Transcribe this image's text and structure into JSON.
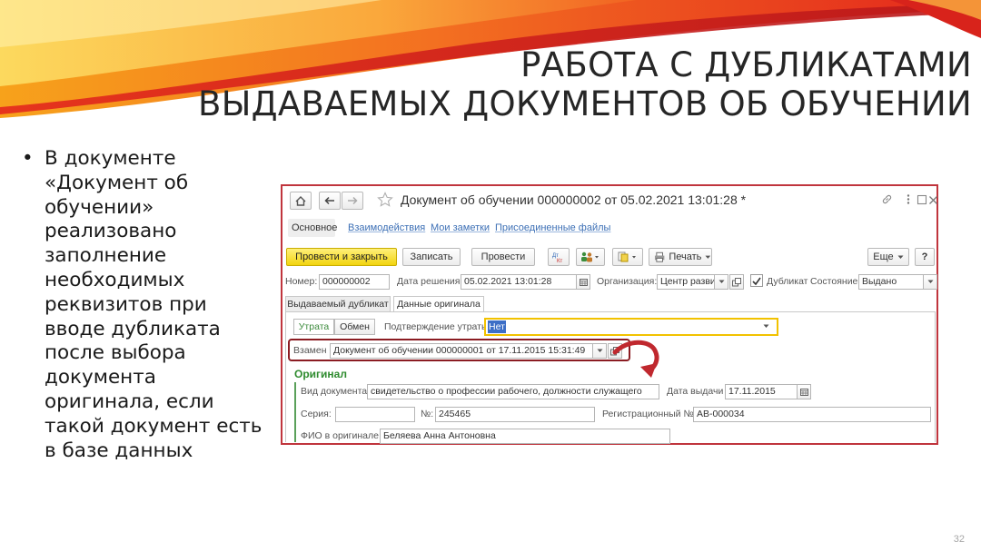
{
  "slide": {
    "title_line1": "РАБОТА С ДУБЛИКАТАМИ",
    "title_line2": "ВЫДАВАЕМЫХ ДОКУМЕНТОВ ОБ ОБУЧЕНИИ",
    "bullet_marker": "•",
    "bullet_text": "В документе «Документ об обучении» реализовано заполнение необходимых реквизитов при вводе дубликата после выбора документа оригинала, если такой документ есть в базе данных",
    "page_number": "32",
    "colors": {
      "swoosh_red": "#e7361a",
      "swoosh_orange": "#f7931e",
      "swoosh_yellow": "#fcd116",
      "window_border": "#c0353d",
      "highlight_yellow": "#f2c200",
      "arrow": "#c0282e"
    }
  },
  "window": {
    "home_icon": "home-icon",
    "back_icon": "arrow-left-icon",
    "forward_icon": "arrow-right-icon",
    "star_icon": "star-icon",
    "title": "Документ об обучении 000000002 от 05.02.2021 13:01:28 *",
    "link_icon": "link-icon",
    "more_icon": "more-vertical-icon",
    "maximize_icon": "maximize-icon",
    "close_icon": "close-icon",
    "nav_tabs": [
      "Основное",
      "Взаимодействия",
      "Мои заметки",
      "Присоединенные файлы"
    ],
    "toolbar": {
      "post_close": "Провести и закрыть",
      "save": "Записать",
      "post": "Провести",
      "print": "Печать",
      "more": "Еще",
      "help": "?"
    },
    "header_fields": {
      "number_label": "Номер:",
      "number_value": "000000002",
      "decision_date_label": "Дата решения",
      "decision_date_value": "05.02.2021 13:01:28",
      "org_label": "Организация:",
      "org_value": "Центр развития",
      "duplicate_label": "Дубликат",
      "duplicate_checked": true,
      "state_label": "Состояние",
      "state_value": "Выдано"
    },
    "doc_tabs": [
      "Выдаваемый дубликат",
      "Данные оригинала"
    ],
    "reason_toggle": [
      "Утрата",
      "Обмен"
    ],
    "loss_confirm_label": "Подтверждение утраты:",
    "loss_confirm_value": "Нет",
    "instead_label": "Взамен",
    "instead_value": "Документ об обучении 000000001 от 17.11.2015 15:31:49",
    "original_section": "Оригинал",
    "doc_type_label": "Вид документа:",
    "doc_type_value": "свидетельство о профессии рабочего, должности служащего",
    "issue_date_label": "Дата выдачи",
    "issue_date_value": "17.11.2015",
    "series_label": "Серия:",
    "series_value": "",
    "number2_label": "№:",
    "number2_value": "245465",
    "reg_number_label": "Регистрационный №:",
    "reg_number_value": "АВ-000034",
    "fio_label": "ФИО в оригинале:",
    "fio_value": "Беляева Анна Антоновна"
  }
}
